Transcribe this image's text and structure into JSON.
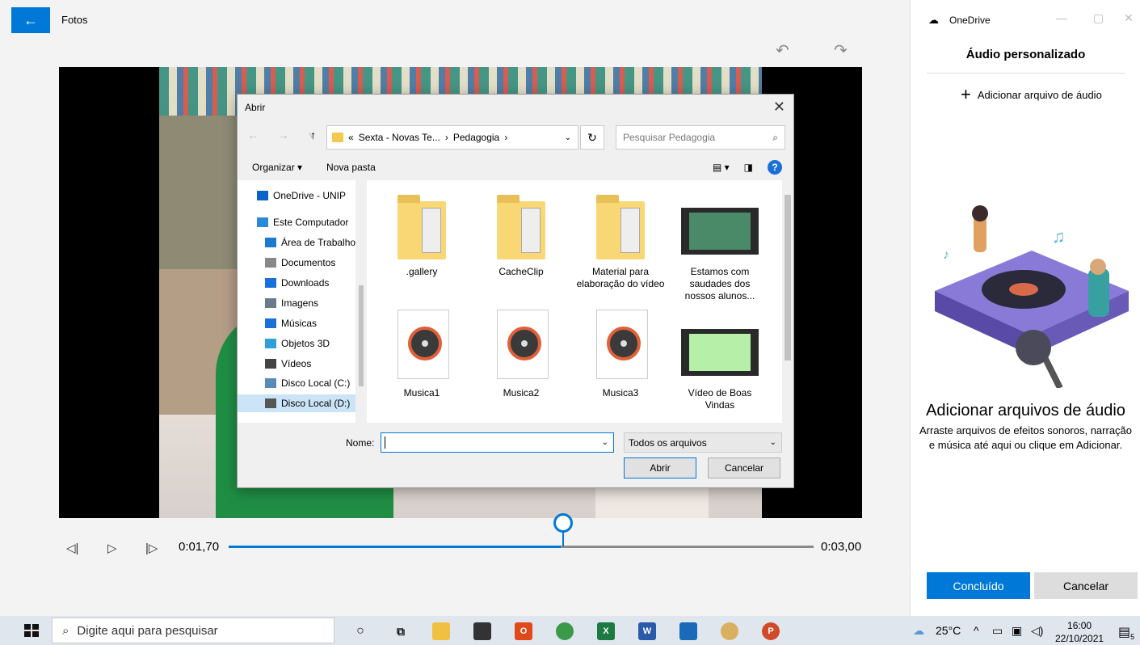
{
  "app": {
    "title": "Fotos",
    "back_icon": "arrow-left-icon"
  },
  "player": {
    "current_time": "0:01,70",
    "total_time": "0:03,00",
    "progress": 0.567
  },
  "panel": {
    "window_title": "OneDrive",
    "heading": "Áudio personalizado",
    "add_audio": "Adicionar arquivo de áudio",
    "empty_title": "Adicionar arquivos de áudio",
    "empty_desc": "Arraste arquivos de efeitos sonoros, narração e música até aqui ou clique em Adicionar.",
    "done": "Concluído",
    "cancel": "Cancelar"
  },
  "dialog": {
    "title": "Abrir",
    "breadcrumb": {
      "prefix": "«",
      "part1": "Sexta - Novas Te...",
      "sep": "›",
      "part2": "Pedagogia"
    },
    "search_placeholder": "Pesquisar Pedagogia",
    "organize": "Organizar ▾",
    "new_folder": "Nova pasta",
    "tree": [
      {
        "label": "OneDrive - UNIP",
        "icon": "cloud-icon",
        "color": "#0a64c8"
      },
      {
        "label": "Este Computador",
        "icon": "computer-icon",
        "color": "#2a8ad8"
      },
      {
        "label": "Área de Trabalho",
        "icon": "desktop-icon",
        "color": "#1a7ad0"
      },
      {
        "label": "Documentos",
        "icon": "documents-icon",
        "color": "#888888"
      },
      {
        "label": "Downloads",
        "icon": "download-icon",
        "color": "#1a6fd8"
      },
      {
        "label": "Imagens",
        "icon": "pictures-icon",
        "color": "#6a7a8a"
      },
      {
        "label": "Músicas",
        "icon": "music-icon",
        "color": "#1a6fd8"
      },
      {
        "label": "Objetos 3D",
        "icon": "3d-objects-icon",
        "color": "#30a0d8"
      },
      {
        "label": "Vídeos",
        "icon": "videos-icon",
        "color": "#444444"
      },
      {
        "label": "Disco Local (C:)",
        "icon": "drive-icon",
        "color": "#5a8ab8"
      },
      {
        "label": "Disco Local (D:)",
        "icon": "drive-icon",
        "color": "#555555"
      }
    ],
    "files": [
      {
        "name": ".gallery",
        "kind": "folder"
      },
      {
        "name": "CacheClip",
        "kind": "folder"
      },
      {
        "name": "Material para elaboração do vídeo",
        "kind": "folder"
      },
      {
        "name": "Estamos com saudades dos nossos alunos...",
        "kind": "video"
      },
      {
        "name": "Musica1",
        "kind": "audio"
      },
      {
        "name": "Musica2",
        "kind": "audio"
      },
      {
        "name": "Musica3",
        "kind": "audio"
      },
      {
        "name": "Vídeo de Boas Vindas",
        "kind": "video-light"
      }
    ],
    "name_label": "Nome:",
    "name_value": "",
    "filter": "Todos os arquivos",
    "open": "Abrir",
    "cancel": "Cancelar"
  },
  "taskbar": {
    "search_placeholder": "Digite aqui para pesquisar",
    "weather": "25°C",
    "time": "16:00",
    "date": "22/10/2021",
    "notifications": "5"
  }
}
